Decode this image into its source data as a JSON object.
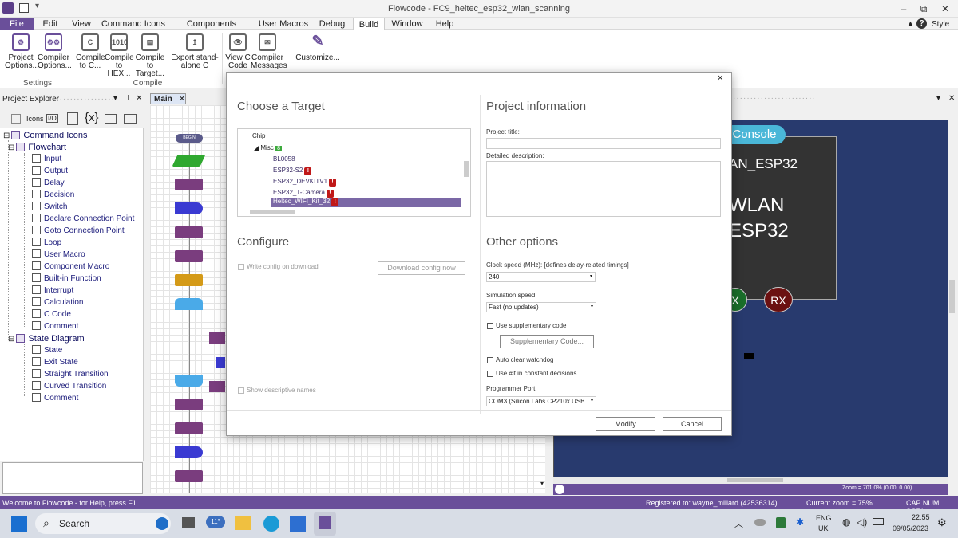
{
  "window": {
    "title": "Flowcode - FC9_heltec_esp32_wlan_scanning",
    "minimize": "–",
    "restore": "⧉",
    "close": "✕"
  },
  "menu": {
    "file": "File",
    "items": [
      "Edit",
      "View",
      "Command Icons",
      "Components Libraries",
      "User Macros",
      "Debug",
      "Build",
      "Window",
      "Help"
    ],
    "help_icon": "?",
    "style": "Style"
  },
  "ribbon": {
    "buttons": [
      {
        "label": "Project Options...",
        "icon": "gear-icon"
      },
      {
        "label": "Compiler Options...",
        "icon": "gears-icon"
      },
      {
        "label": "Compile to C...",
        "icon": "c-file-icon"
      },
      {
        "label": "Compile to HEX...",
        "icon": "binary-icon"
      },
      {
        "label": "Compile to Target...",
        "icon": "chip-compile-icon"
      },
      {
        "label": "Export stand-alone C",
        "icon": "export-icon"
      },
      {
        "label": "View C Code",
        "icon": "view-code-icon"
      },
      {
        "label": "Compiler Messages",
        "icon": "messages-icon"
      },
      {
        "label": "Customize...",
        "icon": "pencil-icon"
      }
    ],
    "groups": {
      "settings": "Settings",
      "compile": "Compile"
    }
  },
  "project_explorer": {
    "title": "Project Explorer",
    "icons_label": "Icons",
    "tree": [
      {
        "label": "Command Icons",
        "level": 0,
        "category": true
      },
      {
        "label": "Flowchart",
        "level": 1,
        "category": true
      },
      {
        "label": "Input",
        "level": 2
      },
      {
        "label": "Output",
        "level": 2
      },
      {
        "label": "Delay",
        "level": 2
      },
      {
        "label": "Decision",
        "level": 2
      },
      {
        "label": "Switch",
        "level": 2
      },
      {
        "label": "Declare Connection Point",
        "level": 2
      },
      {
        "label": "Goto Connection Point",
        "level": 2
      },
      {
        "label": "Loop",
        "level": 2
      },
      {
        "label": "User Macro",
        "level": 2
      },
      {
        "label": "Component Macro",
        "level": 2
      },
      {
        "label": "Built-in Function",
        "level": 2
      },
      {
        "label": "Interrupt",
        "level": 2
      },
      {
        "label": "Calculation",
        "level": 2
      },
      {
        "label": "C Code",
        "level": 2
      },
      {
        "label": "Comment",
        "level": 2
      },
      {
        "label": "State Diagram",
        "level": 1,
        "category": true
      },
      {
        "label": "State",
        "level": 2
      },
      {
        "label": "Exit State",
        "level": 2
      },
      {
        "label": "Straight Transition",
        "level": 2
      },
      {
        "label": "Curved Transition",
        "level": 2
      },
      {
        "label": "Comment",
        "level": 2
      }
    ]
  },
  "flowchart": {
    "tab": "Main",
    "begin": "BEGIN"
  },
  "dialog": {
    "choose_target": "Choose a Target",
    "target_tree": {
      "chip": "Chip",
      "misc": "Misc",
      "misc_count": "8",
      "items": [
        {
          "name": "BL0058",
          "warn": false
        },
        {
          "name": "ESP32-S2",
          "warn": true
        },
        {
          "name": "ESP32_DEVKITV1",
          "warn": true
        },
        {
          "name": "ESP32_T-Camera",
          "warn": true
        },
        {
          "name": "Heltec_WIFI_Kit_32",
          "warn": true,
          "selected": true
        }
      ]
    },
    "configure": "Configure",
    "write_config": "Write config on download",
    "download_config": "Download config now",
    "show_descriptive": "Show descriptive names",
    "project_info": "Project information",
    "project_title_label": "Project title:",
    "detailed_desc_label": "Detailed description:",
    "other_options": "Other options",
    "clock_speed_label": "Clock speed (MHz): [defines delay-related timings]",
    "clock_speed_value": "240",
    "sim_speed_label": "Simulation speed:",
    "sim_speed_value": "Fast (no updates)",
    "use_supp_code": "Use supplementary code",
    "supp_code_btn": "Supplementary Code...",
    "auto_clear": "Auto clear watchdog",
    "use_if": "Use #if in constant decisions",
    "programmer_port_label": "Programmer Port:",
    "programmer_port_value": "COM3 (Silicon Labs CP210x USB",
    "modify": "Modify",
    "cancel": "Cancel",
    "close": "✕"
  },
  "simulation": {
    "console_tab": "Console",
    "board_line1": "AN_ESP32",
    "board_line2": "WLAN",
    "board_line3": "ESP32",
    "tx": "X",
    "rx": "RX",
    "zoom_info": "Zoom = 701.0% (0.00, 0.00)"
  },
  "status": {
    "help": "Welcome to Flowcode - for Help, press F1",
    "registered": "Registered to: wayne_millard (42536314)",
    "zoom": "Current zoom = 75%",
    "keys": "CAP  NUM  SCRL"
  },
  "taskbar": {
    "search": "Search",
    "weather": "11°",
    "lang1": "ENG",
    "lang2": "UK",
    "time": "22:55",
    "date": "09/05/2023"
  },
  "colors": {
    "accent": "#6a4f9a",
    "sim_bg": "#283a6e",
    "console": "#4ab7d8",
    "rx": "#6b1010",
    "tx": "#1a6e2a"
  }
}
